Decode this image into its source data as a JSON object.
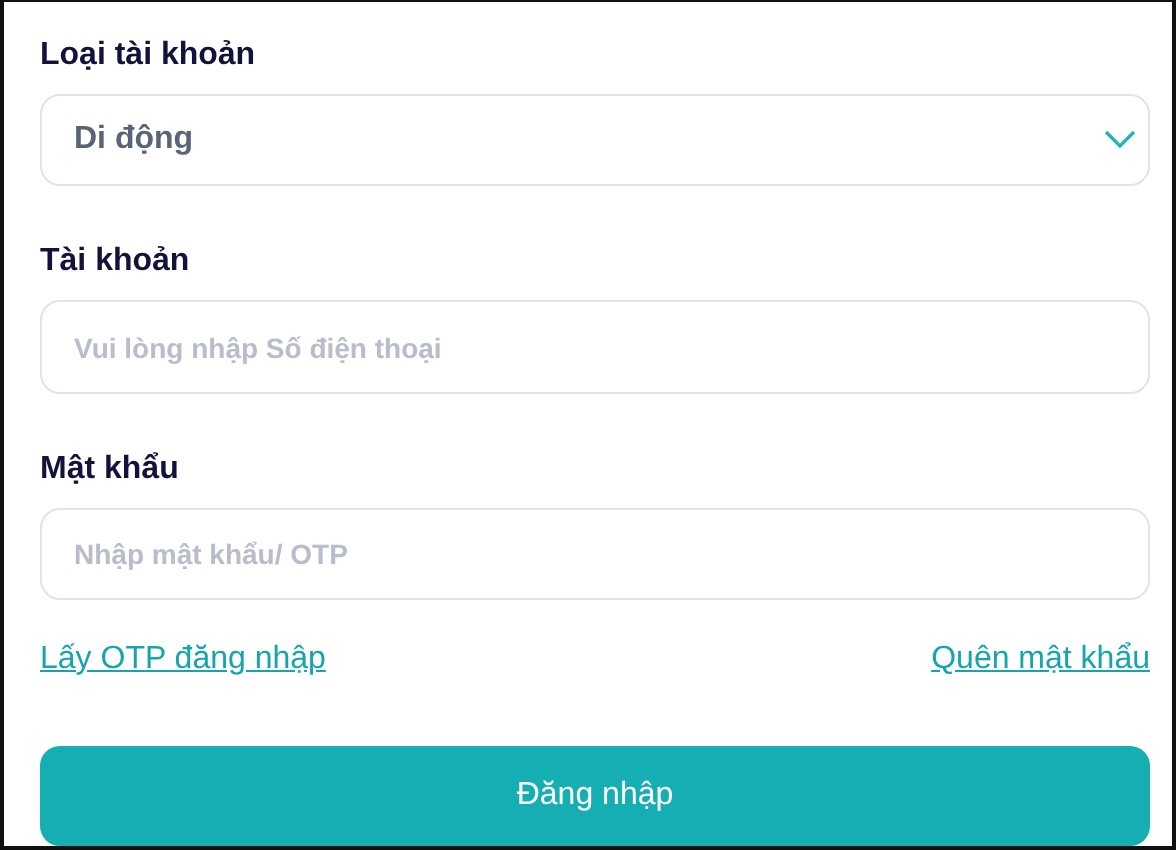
{
  "fields": [
    {
      "kind": "select",
      "label": "Loại tài khoản",
      "value": "Di động"
    },
    {
      "kind": "input",
      "label": "Tài khoản",
      "placeholder": "Vui lòng nhập Số điện thoại"
    },
    {
      "kind": "input",
      "label": "Mật khẩu",
      "placeholder": "Nhập mật khẩu/ OTP"
    }
  ],
  "links": [
    "Lấy OTP đăng nhập",
    "Quên mật khẩu"
  ],
  "submit": "Đăng nhập"
}
